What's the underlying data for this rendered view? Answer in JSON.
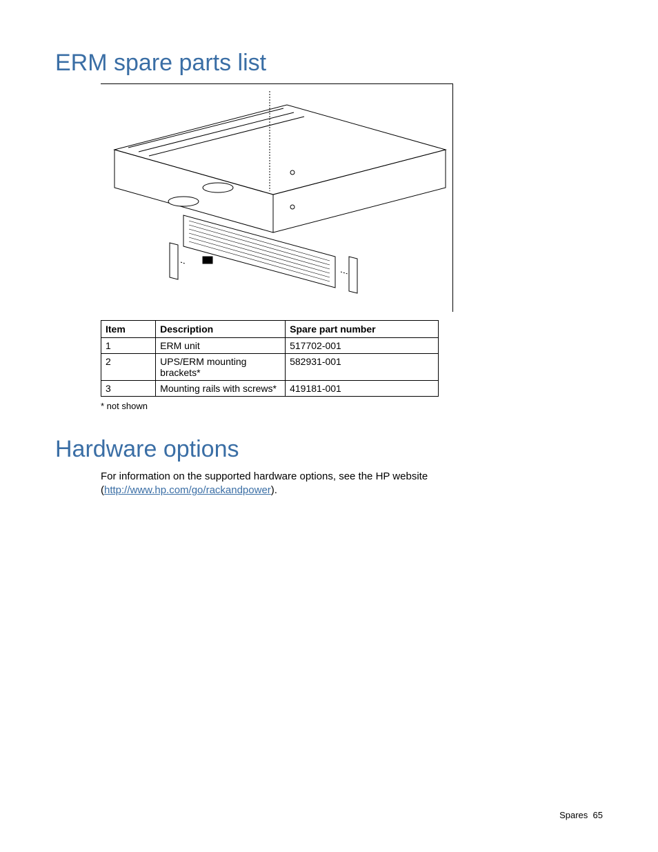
{
  "section1": {
    "heading": "ERM spare parts list",
    "table": {
      "headers": {
        "item": "Item",
        "description": "Description",
        "spare": "Spare part number"
      },
      "rows": [
        {
          "item": "1",
          "description": "ERM unit",
          "spare": "517702-001"
        },
        {
          "item": "2",
          "description": "UPS/ERM mounting brackets*",
          "spare": "582931-001"
        },
        {
          "item": "3",
          "description": "Mounting rails with screws*",
          "spare": "419181-001"
        }
      ]
    },
    "footnote": "* not shown"
  },
  "section2": {
    "heading": "Hardware options",
    "para_pre": "For information on the supported hardware options, see the HP website (",
    "link_text": "http://www.hp.com/go/rackandpower",
    "para_post": ")."
  },
  "footer": {
    "section_label": "Spares",
    "page_number": "65"
  }
}
